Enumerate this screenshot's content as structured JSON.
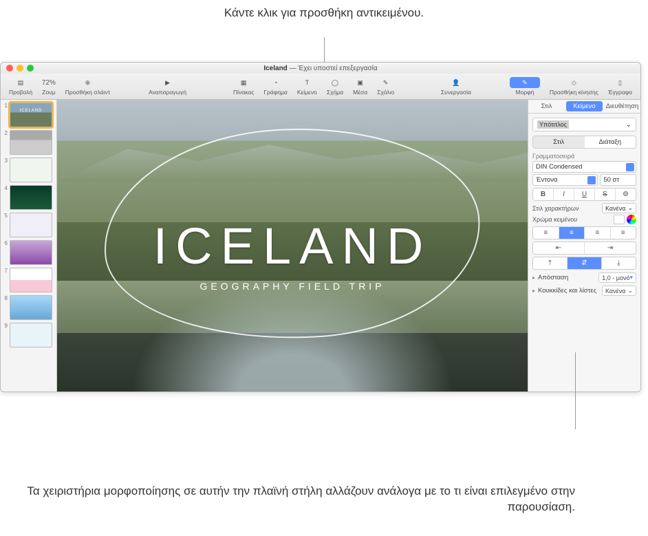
{
  "callouts": {
    "top": "Κάντε κλικ για προσθήκη αντικειμένου.",
    "bottom": "Τα χειριστήρια μορφοποίησης σε αυτήν την πλαϊνή στήλη αλλάζουν ανάλογα με το τι είναι επιλεγμένο στην παρουσίαση."
  },
  "titlebar": {
    "doc_name": "Iceland",
    "status": "— Έχει υποστεί επεξεργασία"
  },
  "toolbar": {
    "view": "Προβολή",
    "zoom_value": "72%",
    "zoom_label": "Ζουμ",
    "add_slide": "Προσθήκη σλάιντ",
    "play": "Αναπαραγωγή",
    "table": "Πίνακας",
    "chart": "Γράφημα",
    "text": "Κείμενο",
    "shape": "Σχήμα",
    "media": "Μέσα",
    "comment": "Σχόλιο",
    "collaborate": "Συνεργασία",
    "format": "Μορφή",
    "animate": "Προσθήκη κίνησης",
    "document": "Έγγραφο"
  },
  "slides": [
    1,
    2,
    3,
    4,
    5,
    6,
    7,
    8,
    9
  ],
  "canvas": {
    "title": "ICELAND",
    "subtitle": "GEOGRAPHY FIELD TRIP"
  },
  "inspector": {
    "tabs": {
      "style": "Στιλ",
      "text": "Κείμενο",
      "arrange": "Διευθέτηση"
    },
    "paragraph_style": "Υπότιτλος",
    "subtabs": {
      "style": "Στιλ",
      "layout": "Διάταξη"
    },
    "font_section": "Γραμματοσειρά",
    "font_family": "DIN Condensed",
    "font_weight": "Έντονα",
    "font_size": "50 στ",
    "char_style_label": "Στιλ χαρακτήρων",
    "char_style_value": "Κανένα",
    "text_color_label": "Χρώμα κειμένου",
    "bold": "B",
    "italic": "I",
    "underline": "U",
    "strike": "S",
    "spacing_label": "Απόσταση",
    "spacing_value": "1,0 - μονό",
    "bullets_label": "Κουκκίδες και λίστες",
    "bullets_value": "Κανένα"
  }
}
